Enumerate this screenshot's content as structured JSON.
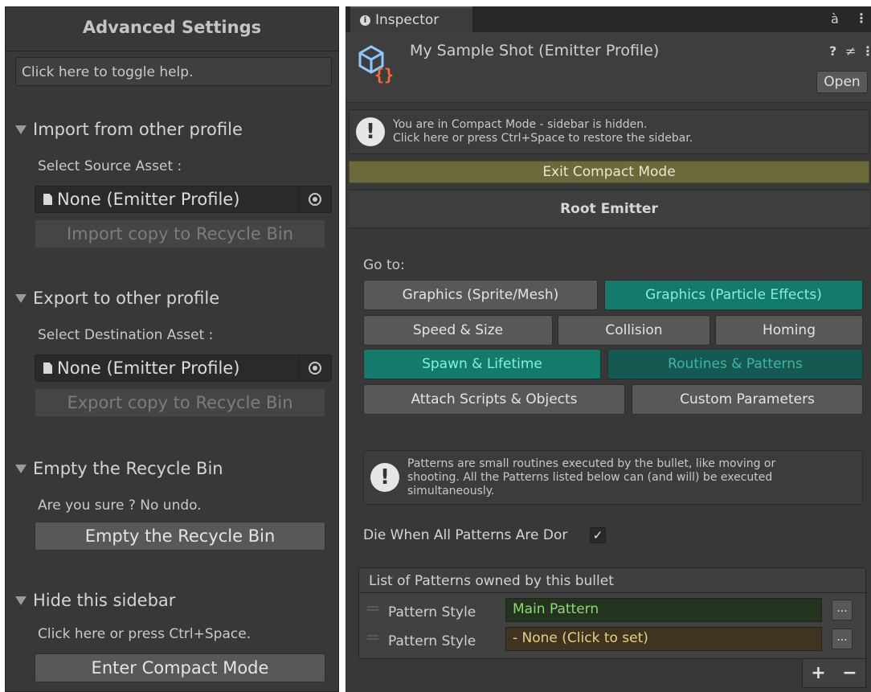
{
  "sidebar": {
    "title": "Advanced Settings",
    "help_toggle": "Click here to toggle help.",
    "import": {
      "header": "Import from other profile",
      "label": "Select Source Asset :",
      "field_value": "None (Emitter Profile)",
      "button": "Import copy to Recycle Bin"
    },
    "export": {
      "header": "Export to other profile",
      "label": "Select Destination Asset :",
      "field_value": "None (Emitter Profile)",
      "button": "Export copy to Recycle Bin"
    },
    "empty": {
      "header": "Empty the Recycle Bin",
      "label": "Are you sure ? No undo.",
      "button": "Empty the Recycle Bin"
    },
    "hide": {
      "header": "Hide this sidebar",
      "label": "Click here or press Ctrl+Space.",
      "button": "Enter Compact Mode"
    }
  },
  "inspector": {
    "tab_label": "Inspector",
    "tab_info_glyph": "i",
    "lock_glyph": "à",
    "menu_glyph": "⋮",
    "asset_title": "My Sample Shot (Emitter Profile)",
    "help_glyph": "?",
    "settings_glyph": "≠",
    "open_button": "Open",
    "compact_notice": {
      "line1": "You are in Compact Mode - sidebar is hidden.",
      "line2": "Click here or press Ctrl+Space to restore the sidebar."
    },
    "exit_compact": "Exit Compact Mode",
    "root_emitter": "Root Emitter",
    "goto_label": "Go to:",
    "nav": {
      "graphics_sprite": "Graphics (Sprite/Mesh)",
      "graphics_particle": "Graphics (Particle Effects)",
      "speed_size": "Speed & Size",
      "collision": "Collision",
      "homing": "Homing",
      "spawn_lifetime": "Spawn & Lifetime",
      "routines_patterns": "Routines & Patterns",
      "attach_scripts": "Attach Scripts & Objects",
      "custom_params": "Custom Parameters"
    },
    "patterns_notice": {
      "line1": "Patterns are small routines executed by the bullet, like moving or",
      "line2": "shooting. All the Patterns listed below can (and will) be executed",
      "line3": "simultaneously."
    },
    "die_label": "Die When All Patterns Are Dor",
    "die_checked": "✓",
    "list": {
      "header": "List of Patterns owned by this bullet",
      "rows": [
        {
          "label": "Pattern Style",
          "value": "Main Pattern",
          "button": "..."
        },
        {
          "label": "Pattern Style",
          "value": "- None (Click to set)",
          "button": "..."
        }
      ],
      "add": "+",
      "remove": "−"
    }
  },
  "colors": {
    "panel_bg": "#383838",
    "teal_active": "#147a6c",
    "teal_text": "#7ff3de",
    "exit_bar": "#6c6a3a",
    "pattern_green": "#8fd67a",
    "pattern_yellow": "#e8cf8a"
  }
}
